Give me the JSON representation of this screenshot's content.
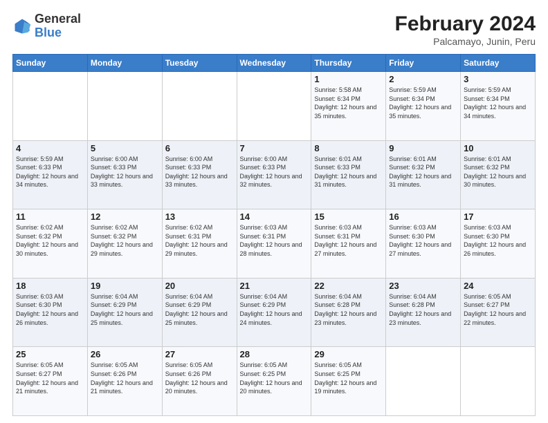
{
  "logo": {
    "line1": "General",
    "line2": "Blue"
  },
  "title": "February 2024",
  "subtitle": "Palcamayo, Junin, Peru",
  "weekdays": [
    "Sunday",
    "Monday",
    "Tuesday",
    "Wednesday",
    "Thursday",
    "Friday",
    "Saturday"
  ],
  "weeks": [
    [
      {
        "day": "",
        "info": ""
      },
      {
        "day": "",
        "info": ""
      },
      {
        "day": "",
        "info": ""
      },
      {
        "day": "",
        "info": ""
      },
      {
        "day": "1",
        "info": "Sunrise: 5:58 AM\nSunset: 6:34 PM\nDaylight: 12 hours\nand 35 minutes."
      },
      {
        "day": "2",
        "info": "Sunrise: 5:59 AM\nSunset: 6:34 PM\nDaylight: 12 hours\nand 35 minutes."
      },
      {
        "day": "3",
        "info": "Sunrise: 5:59 AM\nSunset: 6:34 PM\nDaylight: 12 hours\nand 34 minutes."
      }
    ],
    [
      {
        "day": "4",
        "info": "Sunrise: 5:59 AM\nSunset: 6:33 PM\nDaylight: 12 hours\nand 34 minutes."
      },
      {
        "day": "5",
        "info": "Sunrise: 6:00 AM\nSunset: 6:33 PM\nDaylight: 12 hours\nand 33 minutes."
      },
      {
        "day": "6",
        "info": "Sunrise: 6:00 AM\nSunset: 6:33 PM\nDaylight: 12 hours\nand 33 minutes."
      },
      {
        "day": "7",
        "info": "Sunrise: 6:00 AM\nSunset: 6:33 PM\nDaylight: 12 hours\nand 32 minutes."
      },
      {
        "day": "8",
        "info": "Sunrise: 6:01 AM\nSunset: 6:33 PM\nDaylight: 12 hours\nand 31 minutes."
      },
      {
        "day": "9",
        "info": "Sunrise: 6:01 AM\nSunset: 6:32 PM\nDaylight: 12 hours\nand 31 minutes."
      },
      {
        "day": "10",
        "info": "Sunrise: 6:01 AM\nSunset: 6:32 PM\nDaylight: 12 hours\nand 30 minutes."
      }
    ],
    [
      {
        "day": "11",
        "info": "Sunrise: 6:02 AM\nSunset: 6:32 PM\nDaylight: 12 hours\nand 30 minutes."
      },
      {
        "day": "12",
        "info": "Sunrise: 6:02 AM\nSunset: 6:32 PM\nDaylight: 12 hours\nand 29 minutes."
      },
      {
        "day": "13",
        "info": "Sunrise: 6:02 AM\nSunset: 6:31 PM\nDaylight: 12 hours\nand 29 minutes."
      },
      {
        "day": "14",
        "info": "Sunrise: 6:03 AM\nSunset: 6:31 PM\nDaylight: 12 hours\nand 28 minutes."
      },
      {
        "day": "15",
        "info": "Sunrise: 6:03 AM\nSunset: 6:31 PM\nDaylight: 12 hours\nand 27 minutes."
      },
      {
        "day": "16",
        "info": "Sunrise: 6:03 AM\nSunset: 6:30 PM\nDaylight: 12 hours\nand 27 minutes."
      },
      {
        "day": "17",
        "info": "Sunrise: 6:03 AM\nSunset: 6:30 PM\nDaylight: 12 hours\nand 26 minutes."
      }
    ],
    [
      {
        "day": "18",
        "info": "Sunrise: 6:03 AM\nSunset: 6:30 PM\nDaylight: 12 hours\nand 26 minutes."
      },
      {
        "day": "19",
        "info": "Sunrise: 6:04 AM\nSunset: 6:29 PM\nDaylight: 12 hours\nand 25 minutes."
      },
      {
        "day": "20",
        "info": "Sunrise: 6:04 AM\nSunset: 6:29 PM\nDaylight: 12 hours\nand 25 minutes."
      },
      {
        "day": "21",
        "info": "Sunrise: 6:04 AM\nSunset: 6:29 PM\nDaylight: 12 hours\nand 24 minutes."
      },
      {
        "day": "22",
        "info": "Sunrise: 6:04 AM\nSunset: 6:28 PM\nDaylight: 12 hours\nand 23 minutes."
      },
      {
        "day": "23",
        "info": "Sunrise: 6:04 AM\nSunset: 6:28 PM\nDaylight: 12 hours\nand 23 minutes."
      },
      {
        "day": "24",
        "info": "Sunrise: 6:05 AM\nSunset: 6:27 PM\nDaylight: 12 hours\nand 22 minutes."
      }
    ],
    [
      {
        "day": "25",
        "info": "Sunrise: 6:05 AM\nSunset: 6:27 PM\nDaylight: 12 hours\nand 21 minutes."
      },
      {
        "day": "26",
        "info": "Sunrise: 6:05 AM\nSunset: 6:26 PM\nDaylight: 12 hours\nand 21 minutes."
      },
      {
        "day": "27",
        "info": "Sunrise: 6:05 AM\nSunset: 6:26 PM\nDaylight: 12 hours\nand 20 minutes."
      },
      {
        "day": "28",
        "info": "Sunrise: 6:05 AM\nSunset: 6:25 PM\nDaylight: 12 hours\nand 20 minutes."
      },
      {
        "day": "29",
        "info": "Sunrise: 6:05 AM\nSunset: 6:25 PM\nDaylight: 12 hours\nand 19 minutes."
      },
      {
        "day": "",
        "info": ""
      },
      {
        "day": "",
        "info": ""
      }
    ]
  ]
}
